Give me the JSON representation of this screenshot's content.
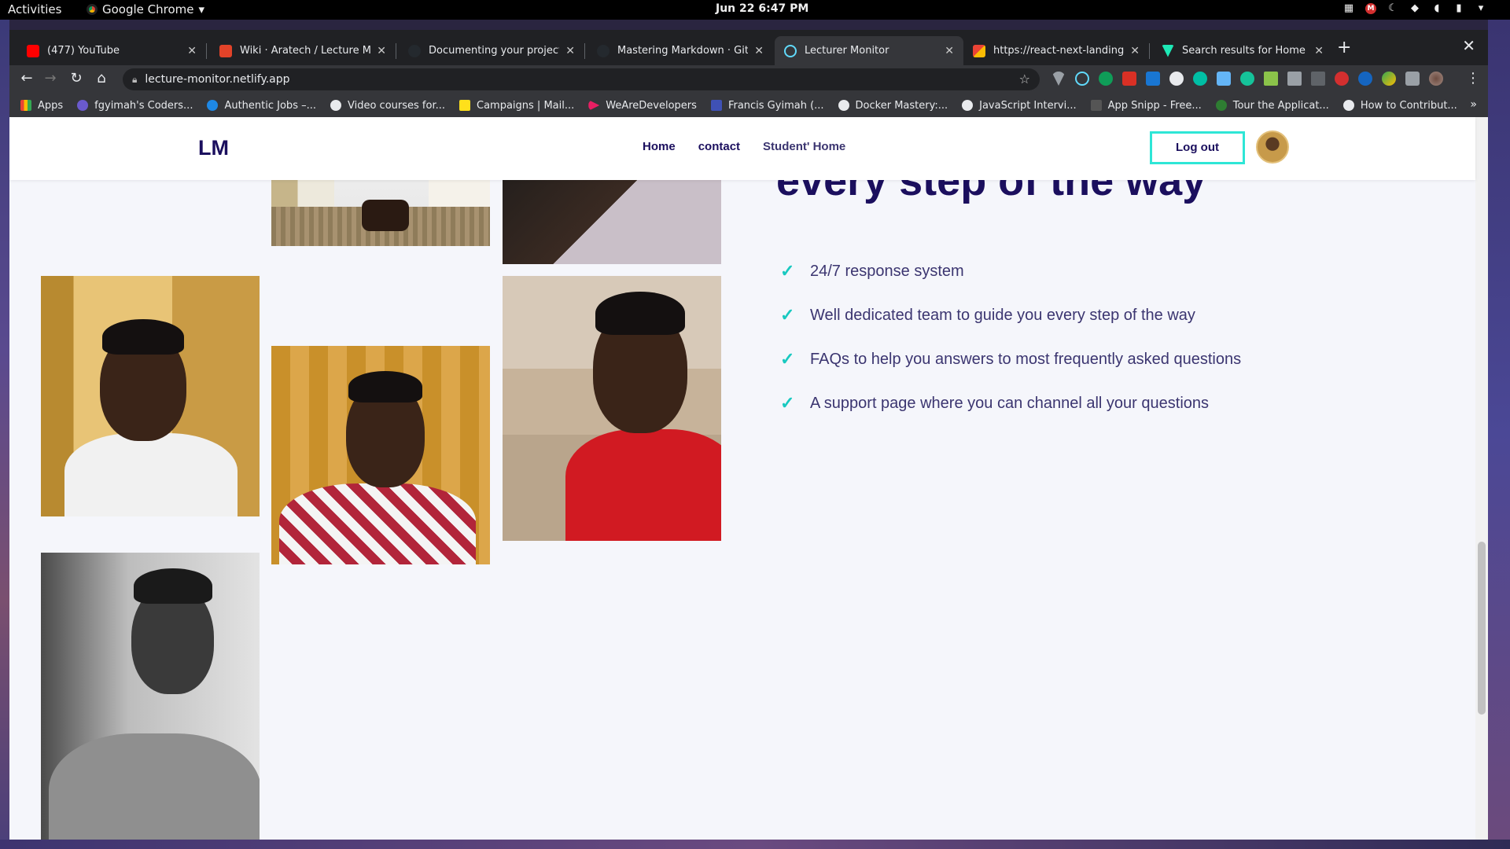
{
  "system": {
    "activities": "Activities",
    "app_name": "Google Chrome",
    "clock": "Jun 22  6:47 PM"
  },
  "tabs": [
    {
      "title": "(477) YouTube",
      "color": "#ff0000"
    },
    {
      "title": "Wiki · Aratech / Lecture Monit",
      "color": "#e24329"
    },
    {
      "title": "Documenting your projects o",
      "color": "#24292e"
    },
    {
      "title": "Mastering Markdown · GitHub",
      "color": "#24292e"
    },
    {
      "title": "Lecturer Monitor",
      "color": "#61dafb"
    },
    {
      "title": "https://react-next-landing.re",
      "color": "#ea4335"
    },
    {
      "title": "Search results for Home - Fla",
      "color": "#1de9b6"
    }
  ],
  "address_bar": {
    "url": "lecture-monitor.netlify.app"
  },
  "bookmarks": [
    {
      "label": "Apps",
      "color": "#4285f4"
    },
    {
      "label": "fgyimah's Coders...",
      "color": "#6a5acd"
    },
    {
      "label": "Authentic Jobs –...",
      "color": "#1e88e5"
    },
    {
      "label": "Video courses for...",
      "color": "#e8eaed"
    },
    {
      "label": "Campaigns | Mail...",
      "color": "#ffe01b"
    },
    {
      "label": "WeAreDevelopers",
      "color": "#e91e63"
    },
    {
      "label": "Francis Gyimah (...",
      "color": "#3f51b5"
    },
    {
      "label": "Docker Mastery:...",
      "color": "#e8eaed"
    },
    {
      "label": "JavaScript Intervi...",
      "color": "#e8eaed"
    },
    {
      "label": "App Snipp - Free...",
      "color": "#555555"
    },
    {
      "label": "Tour the Applicat...",
      "color": "#2e7d32"
    },
    {
      "label": "How to Contribut...",
      "color": "#e8eaed"
    }
  ],
  "site": {
    "logo": "LM",
    "nav": [
      "Home",
      "contact",
      "Student' Home"
    ],
    "logout": "Log out",
    "headline": "every step of the way",
    "features": [
      "24/7 response system",
      "Well dedicated team to guide you every step of the way",
      "FAQs to help you answers to most frequently asked questions",
      "A support page where you can channel all your questions"
    ],
    "accent_color": "#2ee6d6",
    "brand_color": "#1b0f5e"
  }
}
